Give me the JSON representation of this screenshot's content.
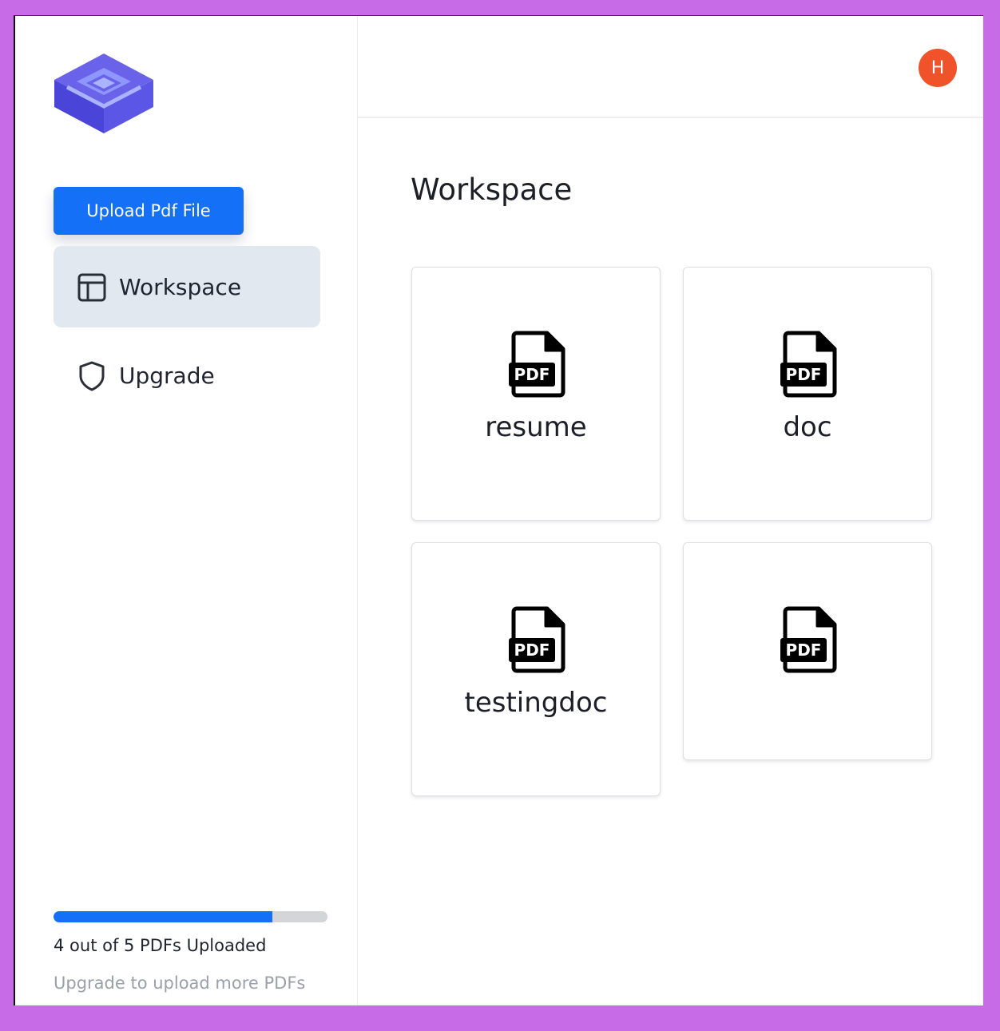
{
  "sidebar": {
    "upload_button": "Upload Pdf File",
    "nav": [
      {
        "label": "Workspace",
        "icon": "layout-icon",
        "active": true
      },
      {
        "label": "Upgrade",
        "icon": "shield-icon",
        "active": false
      }
    ],
    "quota": {
      "uploaded": 4,
      "limit": 5,
      "fraction": 0.8,
      "text": "4 out of 5 PDFs Uploaded",
      "hint": "Upgrade to upload more PDFs"
    }
  },
  "header": {
    "avatar_initial": "H",
    "avatar_color": "#f0522a"
  },
  "main": {
    "title": "Workspace",
    "files": [
      {
        "name": "resume",
        "icon": "pdf-file-icon",
        "badge": "PDF"
      },
      {
        "name": "doc",
        "icon": "pdf-file-icon",
        "badge": "PDF"
      },
      {
        "name": "testingdoc",
        "icon": "pdf-file-icon",
        "badge": "PDF"
      },
      {
        "name": "",
        "icon": "pdf-file-icon",
        "badge": "PDF"
      }
    ]
  },
  "colors": {
    "accent": "#1470f7",
    "active_nav_bg": "#e2e8f0",
    "page_border": "#c86be6",
    "logo_primary": "#5b5ff0"
  }
}
